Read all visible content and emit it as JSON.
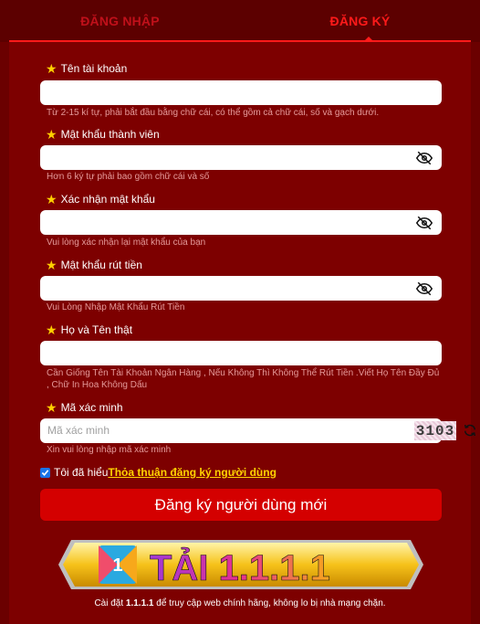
{
  "tabs": {
    "login": "ĐĂNG NHẬP",
    "register": "ĐĂNG KÝ"
  },
  "fields": [
    {
      "label": "Tên tài khoản",
      "value": "",
      "hint": "Từ 2-15 kí tự, phải bắt đầu bằng chữ cái, có thể gồm cả chữ cái, số và gạch dưới."
    },
    {
      "label": "Mật khẩu thành viên",
      "value": "",
      "hint": "Hơn 6 ký tự phải bao gồm chữ cái và số"
    },
    {
      "label": "Xác nhận mật khẩu",
      "value": "",
      "hint": "Vui lòng xác nhận lại mật khẩu của bạn"
    },
    {
      "label": "Mật khẩu rút tiền",
      "value": "",
      "hint": "Vui Lòng Nhập Mật Khẩu Rút Tiền"
    },
    {
      "label": "Họ và Tên thật",
      "value": "",
      "hint_line1": "Cần Giống Tên Tài Khoản Ngân Hàng , Nếu Không Thì Không Thể Rút Tiền .Viết Họ Tên Đầy Đủ",
      "hint_line2": ", Chữ In Hoa Không Dấu"
    },
    {
      "label": "Mã xác minh",
      "placeholder": "Mã xác minh",
      "captcha_code": "3103",
      "hint": "Xin vui lòng nhập mã xác minh"
    }
  ],
  "icons": {
    "star": "star-icon",
    "eye": "eye-off-icon",
    "refresh": "refresh-icon",
    "check": "check-icon"
  },
  "agree": {
    "text": "Tôi đã hiểu",
    "link": "Thỏa thuận đăng ký người dùng",
    "checked": true
  },
  "submit_label": "Đăng ký người dùng mới",
  "banner": {
    "text": "TẢI 1.1.1.1",
    "badge": "1"
  },
  "promo": {
    "prefix": "Cài đặt ",
    "highlight": "1.1.1.1",
    "suffix": " để truy cập web chính hãng, không lo bị nhà mạng chặn."
  },
  "colors": {
    "background": "#6b0000",
    "panel": "#7d0000",
    "accent": "#ff1a1a",
    "button": "#d40000",
    "link": "#ffd400",
    "star": "#ffd000"
  }
}
